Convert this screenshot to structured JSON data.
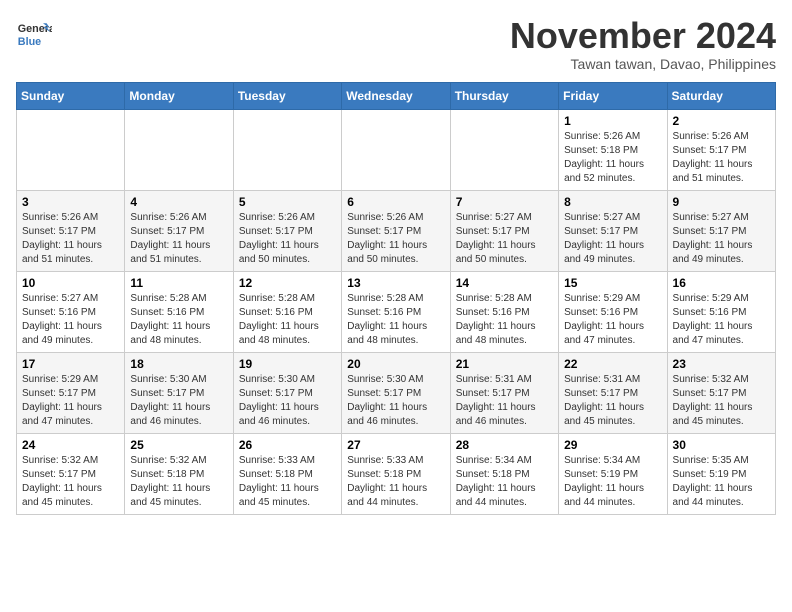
{
  "header": {
    "logo_line1": "General",
    "logo_line2": "Blue",
    "month": "November 2024",
    "location": "Tawan tawan, Davao, Philippines"
  },
  "weekdays": [
    "Sunday",
    "Monday",
    "Tuesday",
    "Wednesday",
    "Thursday",
    "Friday",
    "Saturday"
  ],
  "weeks": [
    [
      {
        "day": "",
        "info": ""
      },
      {
        "day": "",
        "info": ""
      },
      {
        "day": "",
        "info": ""
      },
      {
        "day": "",
        "info": ""
      },
      {
        "day": "",
        "info": ""
      },
      {
        "day": "1",
        "info": "Sunrise: 5:26 AM\nSunset: 5:18 PM\nDaylight: 11 hours and 52 minutes."
      },
      {
        "day": "2",
        "info": "Sunrise: 5:26 AM\nSunset: 5:17 PM\nDaylight: 11 hours and 51 minutes."
      }
    ],
    [
      {
        "day": "3",
        "info": "Sunrise: 5:26 AM\nSunset: 5:17 PM\nDaylight: 11 hours and 51 minutes."
      },
      {
        "day": "4",
        "info": "Sunrise: 5:26 AM\nSunset: 5:17 PM\nDaylight: 11 hours and 51 minutes."
      },
      {
        "day": "5",
        "info": "Sunrise: 5:26 AM\nSunset: 5:17 PM\nDaylight: 11 hours and 50 minutes."
      },
      {
        "day": "6",
        "info": "Sunrise: 5:26 AM\nSunset: 5:17 PM\nDaylight: 11 hours and 50 minutes."
      },
      {
        "day": "7",
        "info": "Sunrise: 5:27 AM\nSunset: 5:17 PM\nDaylight: 11 hours and 50 minutes."
      },
      {
        "day": "8",
        "info": "Sunrise: 5:27 AM\nSunset: 5:17 PM\nDaylight: 11 hours and 49 minutes."
      },
      {
        "day": "9",
        "info": "Sunrise: 5:27 AM\nSunset: 5:17 PM\nDaylight: 11 hours and 49 minutes."
      }
    ],
    [
      {
        "day": "10",
        "info": "Sunrise: 5:27 AM\nSunset: 5:16 PM\nDaylight: 11 hours and 49 minutes."
      },
      {
        "day": "11",
        "info": "Sunrise: 5:28 AM\nSunset: 5:16 PM\nDaylight: 11 hours and 48 minutes."
      },
      {
        "day": "12",
        "info": "Sunrise: 5:28 AM\nSunset: 5:16 PM\nDaylight: 11 hours and 48 minutes."
      },
      {
        "day": "13",
        "info": "Sunrise: 5:28 AM\nSunset: 5:16 PM\nDaylight: 11 hours and 48 minutes."
      },
      {
        "day": "14",
        "info": "Sunrise: 5:28 AM\nSunset: 5:16 PM\nDaylight: 11 hours and 48 minutes."
      },
      {
        "day": "15",
        "info": "Sunrise: 5:29 AM\nSunset: 5:16 PM\nDaylight: 11 hours and 47 minutes."
      },
      {
        "day": "16",
        "info": "Sunrise: 5:29 AM\nSunset: 5:16 PM\nDaylight: 11 hours and 47 minutes."
      }
    ],
    [
      {
        "day": "17",
        "info": "Sunrise: 5:29 AM\nSunset: 5:17 PM\nDaylight: 11 hours and 47 minutes."
      },
      {
        "day": "18",
        "info": "Sunrise: 5:30 AM\nSunset: 5:17 PM\nDaylight: 11 hours and 46 minutes."
      },
      {
        "day": "19",
        "info": "Sunrise: 5:30 AM\nSunset: 5:17 PM\nDaylight: 11 hours and 46 minutes."
      },
      {
        "day": "20",
        "info": "Sunrise: 5:30 AM\nSunset: 5:17 PM\nDaylight: 11 hours and 46 minutes."
      },
      {
        "day": "21",
        "info": "Sunrise: 5:31 AM\nSunset: 5:17 PM\nDaylight: 11 hours and 46 minutes."
      },
      {
        "day": "22",
        "info": "Sunrise: 5:31 AM\nSunset: 5:17 PM\nDaylight: 11 hours and 45 minutes."
      },
      {
        "day": "23",
        "info": "Sunrise: 5:32 AM\nSunset: 5:17 PM\nDaylight: 11 hours and 45 minutes."
      }
    ],
    [
      {
        "day": "24",
        "info": "Sunrise: 5:32 AM\nSunset: 5:17 PM\nDaylight: 11 hours and 45 minutes."
      },
      {
        "day": "25",
        "info": "Sunrise: 5:32 AM\nSunset: 5:18 PM\nDaylight: 11 hours and 45 minutes."
      },
      {
        "day": "26",
        "info": "Sunrise: 5:33 AM\nSunset: 5:18 PM\nDaylight: 11 hours and 45 minutes."
      },
      {
        "day": "27",
        "info": "Sunrise: 5:33 AM\nSunset: 5:18 PM\nDaylight: 11 hours and 44 minutes."
      },
      {
        "day": "28",
        "info": "Sunrise: 5:34 AM\nSunset: 5:18 PM\nDaylight: 11 hours and 44 minutes."
      },
      {
        "day": "29",
        "info": "Sunrise: 5:34 AM\nSunset: 5:19 PM\nDaylight: 11 hours and 44 minutes."
      },
      {
        "day": "30",
        "info": "Sunrise: 5:35 AM\nSunset: 5:19 PM\nDaylight: 11 hours and 44 minutes."
      }
    ]
  ]
}
